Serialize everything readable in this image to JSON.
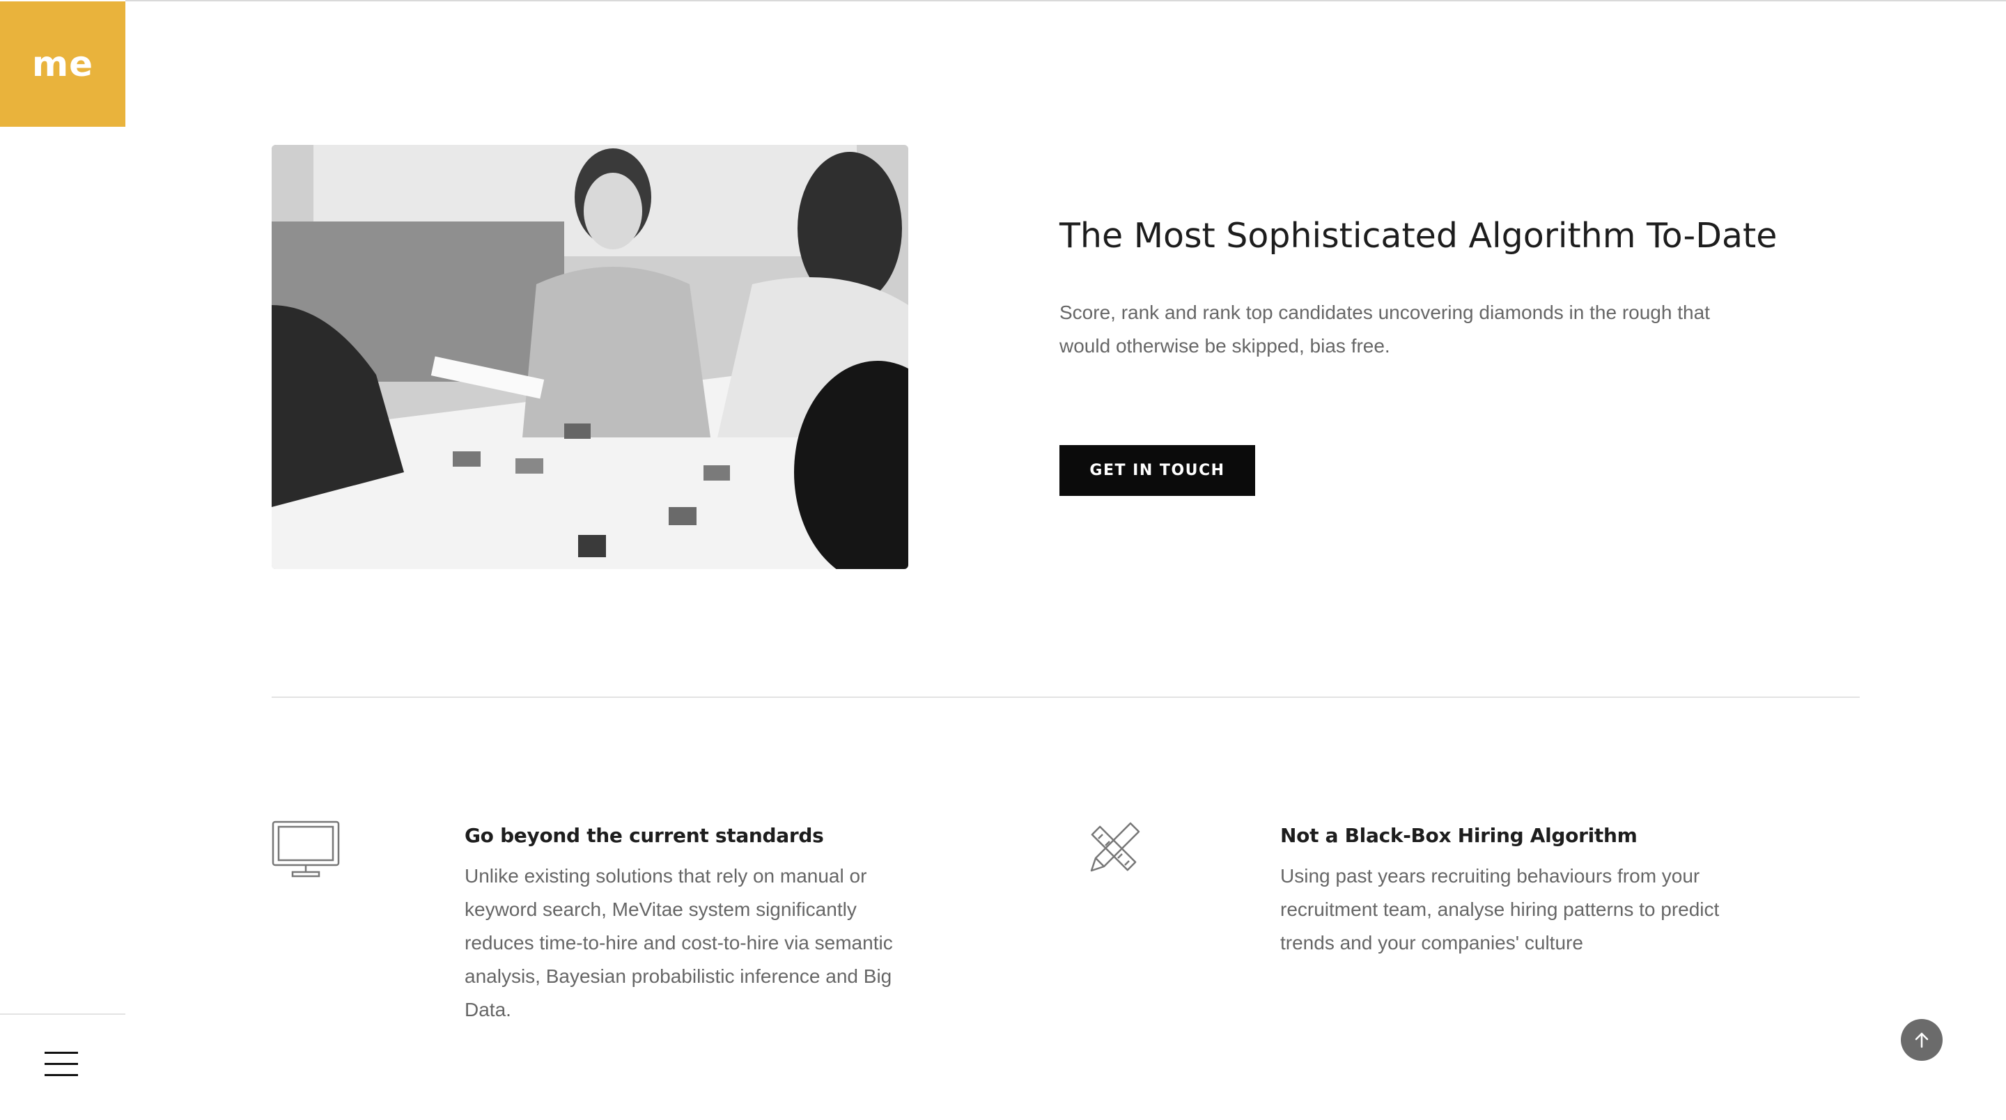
{
  "brand": {
    "logo_text": "me",
    "accent_color": "#e9b33c"
  },
  "hero": {
    "image_alt": "group of people laughing around a table with photos",
    "title": "The Most Sophisticated Algorithm To-Date",
    "text": "Score, rank and rank top candidates uncovering diamonds in the rough that would otherwise be skipped, bias free.",
    "cta_label": "GET IN TOUCH"
  },
  "features": [
    {
      "icon": "monitor-icon",
      "title": "Go beyond the current standards",
      "text": "Unlike existing solutions that rely on manual or keyword search, MeVitae system significantly reduces time-to-hire and cost-to-hire via semantic analysis, Bayesian probabilistic inference and Big Data."
    },
    {
      "icon": "pencil-ruler-icon",
      "title": "Not a Black-Box Hiring Algorithm",
      "text": "Using past years recruiting behaviours from your recruitment team, analyse hiring patterns to predict trends and your companies' culture"
    }
  ],
  "controls": {
    "menu_icon": "hamburger-icon",
    "scroll_top_icon": "arrow-up-icon"
  }
}
